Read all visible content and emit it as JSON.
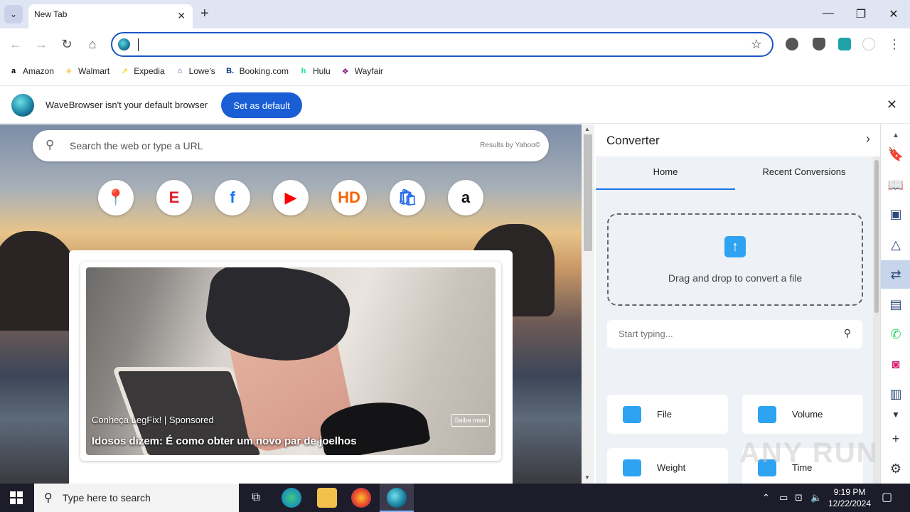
{
  "browser": {
    "tab_title": "New Tab",
    "omnibox_value": "",
    "bookmarks": [
      {
        "label": "Amazon",
        "icon": "amazon-icon",
        "color": "#000000",
        "glyph": "a"
      },
      {
        "label": "Walmart",
        "icon": "walmart-icon",
        "color": "#f5b50b",
        "glyph": "✳"
      },
      {
        "label": "Expedia",
        "icon": "expedia-icon",
        "color": "#fcd116",
        "glyph": "↗"
      },
      {
        "label": "Lowe's",
        "icon": "lowes-icon",
        "color": "#004990",
        "glyph": "⌂"
      },
      {
        "label": "Booking.com",
        "icon": "booking-icon",
        "color": "#003580",
        "glyph": "B."
      },
      {
        "label": "Hulu",
        "icon": "hulu-icon",
        "color": "#1ce783",
        "glyph": "h"
      },
      {
        "label": "Wayfair",
        "icon": "wayfair-icon",
        "color": "#7f187f",
        "glyph": "❖"
      }
    ]
  },
  "infobar": {
    "message": "WaveBrowser isn't your default browser",
    "button_label": "Set as default"
  },
  "newtab": {
    "search_placeholder": "Search the web or type a URL",
    "search_provider": "Results by Yahoo©",
    "shortcuts": [
      {
        "name": "google-maps",
        "glyph": "📍",
        "color": "#ea4335"
      },
      {
        "name": "espn",
        "glyph": "E",
        "color": "#e31b23"
      },
      {
        "name": "facebook",
        "glyph": "f",
        "color": "#1877f2"
      },
      {
        "name": "youtube",
        "glyph": "▶",
        "color": "#ff0000"
      },
      {
        "name": "home-depot",
        "glyph": "HD",
        "color": "#f96302"
      },
      {
        "name": "shop",
        "glyph": "🛍",
        "color": "#2a6ee8"
      },
      {
        "name": "amazon",
        "glyph": "a",
        "color": "#111111"
      }
    ],
    "ad": {
      "brand": "Conheça LegFix! | Sponsored",
      "headline": "Idosos dizem: É como obter um novo par de joelhos",
      "more": "Saiba mais"
    }
  },
  "converter": {
    "title": "Converter",
    "tabs": [
      "Home",
      "Recent Conversions"
    ],
    "dropzone_text": "Drag and drop to convert a file",
    "search_placeholder": "Start typing...",
    "tiles": [
      {
        "label": "File",
        "icon": "folder-icon",
        "color": "#2ea3f2"
      },
      {
        "label": "Volume",
        "icon": "flask-icon",
        "color": "#2ea3f2"
      },
      {
        "label": "Weight",
        "icon": "weights-icon",
        "color": "#2ea3f2"
      },
      {
        "label": "Time",
        "icon": "stopwatch-icon",
        "color": "#2ea3f2"
      }
    ]
  },
  "watermark": "ANY RUN",
  "taskbar": {
    "search_text": "Type here to search",
    "time": "9:19 PM",
    "date": "12/22/2024"
  }
}
